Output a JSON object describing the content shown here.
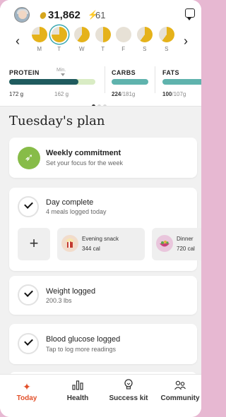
{
  "header": {
    "points": "31,862",
    "streak": "61",
    "week": {
      "days": [
        {
          "label": "M",
          "fill": 0.75,
          "selected": false
        },
        {
          "label": "T",
          "fill": 0.75,
          "selected": true
        },
        {
          "label": "W",
          "fill": 0.6,
          "selected": false
        },
        {
          "label": "T",
          "fill": 0.5,
          "selected": false
        },
        {
          "label": "F",
          "fill": 0,
          "selected": false
        },
        {
          "label": "S",
          "fill": 0.6,
          "selected": false
        },
        {
          "label": "S",
          "fill": 0.6,
          "selected": false
        }
      ]
    },
    "macros": {
      "protein": {
        "title": "PROTEIN",
        "min_label": "Min.",
        "value": "172 g",
        "target": "162 g"
      },
      "carbs": {
        "title": "CARBS",
        "value": "224",
        "target": "/181g"
      },
      "fats": {
        "title": "FATS",
        "value": "100",
        "target": "/107g"
      }
    },
    "colors": {
      "accent_yellow": "#e5b21a",
      "teal": "#5fb3ad",
      "dark_teal": "#1f5b5e",
      "brand_red": "#e2502a"
    }
  },
  "main": {
    "title": "Tuesday's plan",
    "weekly": {
      "title": "Weekly commitment",
      "subtitle": "Set your focus for the week"
    },
    "day_complete": {
      "title": "Day complete",
      "subtitle": "4 meals logged today"
    },
    "meals": [
      {
        "name": "Evening snack",
        "cal": "344 cal"
      },
      {
        "name": "Dinner",
        "cal": "720 cal"
      }
    ],
    "weight": {
      "title": "Weight logged",
      "subtitle": "200.3 lbs"
    },
    "glucose": {
      "title": "Blood glucose logged",
      "subtitle": "Tap to log more readings"
    }
  },
  "nav": {
    "items": [
      {
        "label": "Today",
        "icon": "sparkle-icon"
      },
      {
        "label": "Health",
        "icon": "bar-chart-icon"
      },
      {
        "label": "Success kit",
        "icon": "lightbulb-icon"
      },
      {
        "label": "Community",
        "icon": "people-icon"
      }
    ]
  }
}
